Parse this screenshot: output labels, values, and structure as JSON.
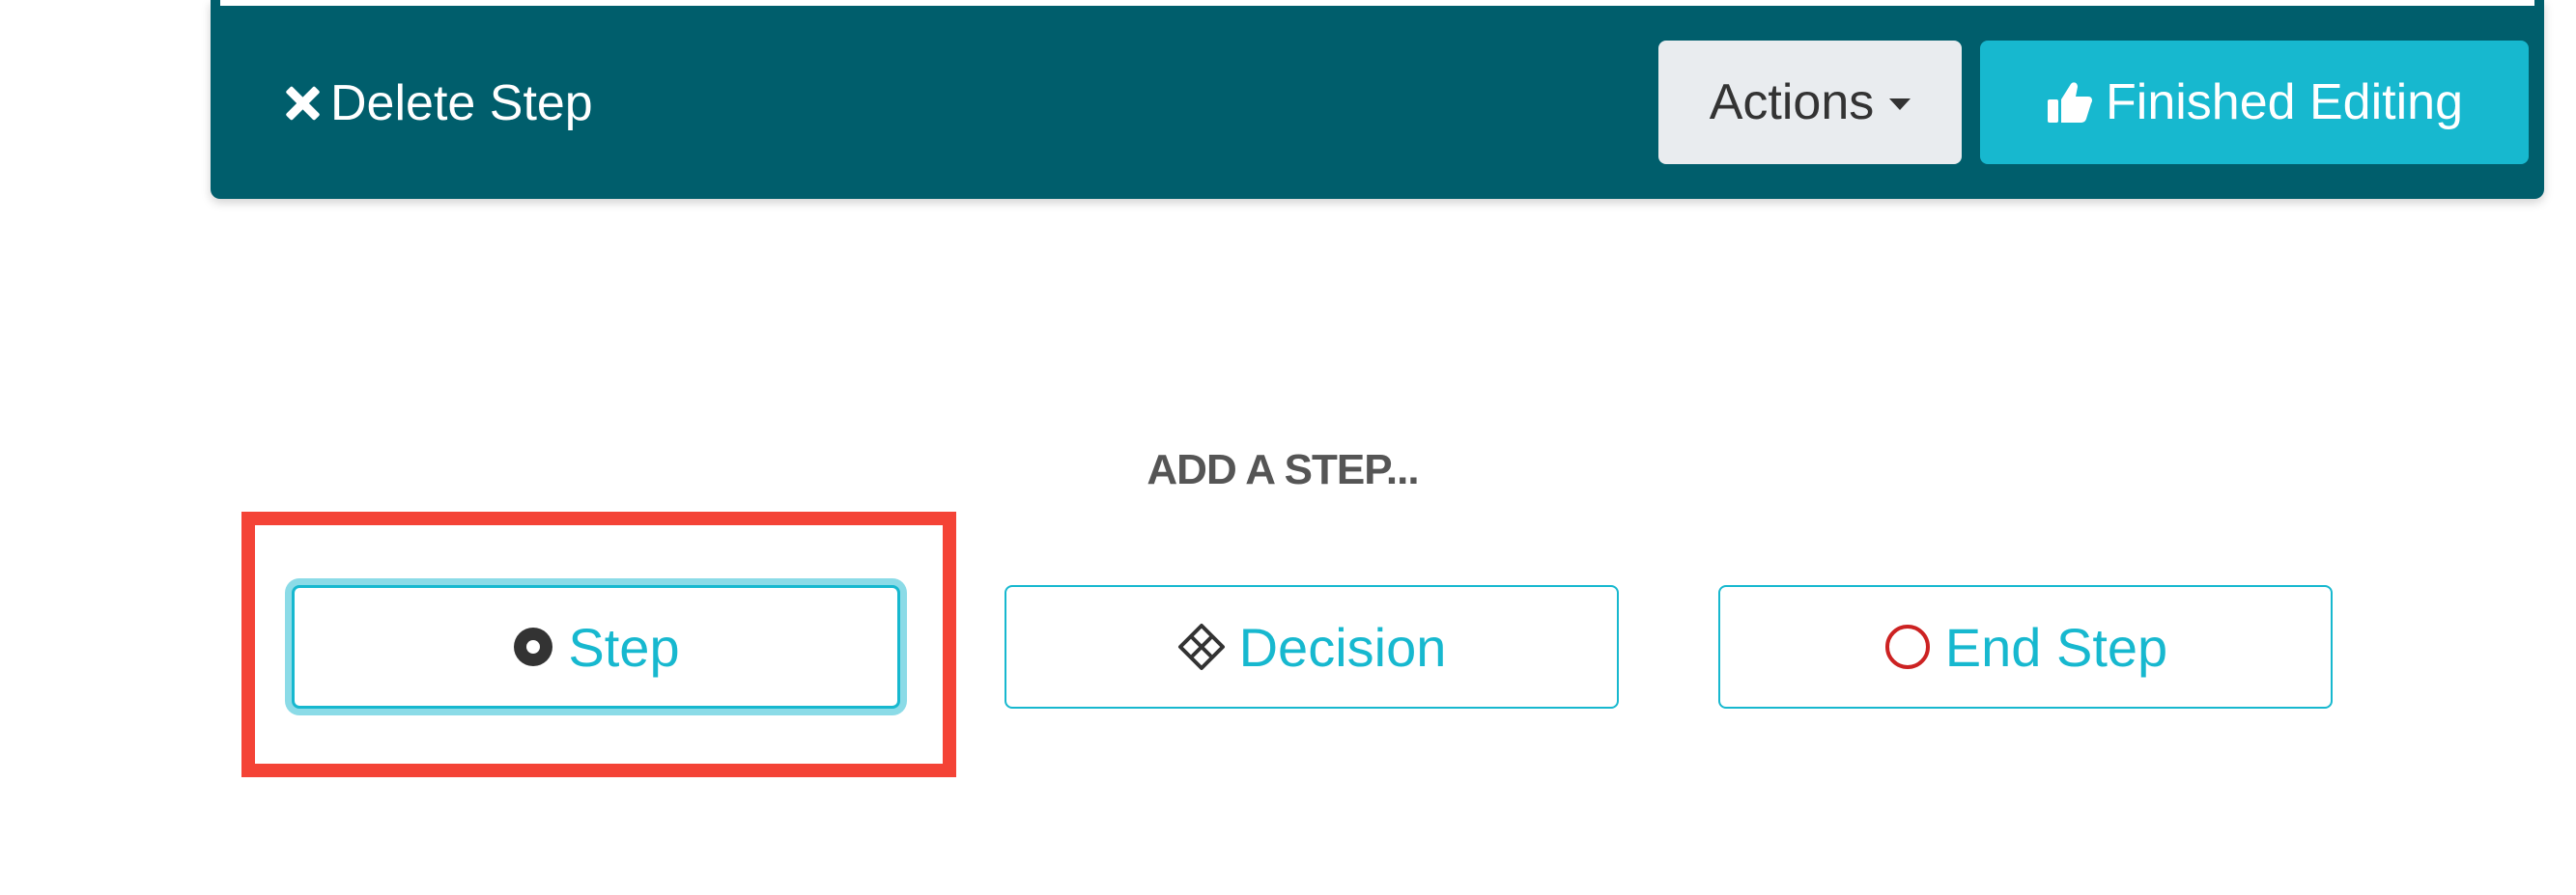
{
  "step_card": {
    "delete_label": "Delete Step",
    "actions_label": "Actions",
    "finished_label": "Finished Editing"
  },
  "add_step": {
    "heading": "ADD A STEP...",
    "buttons": [
      {
        "label": "Step",
        "icon": "dot-circle-icon"
      },
      {
        "label": "Decision",
        "icon": "diamond-icon"
      },
      {
        "label": "End Step",
        "icon": "circle-icon"
      }
    ]
  },
  "colors": {
    "card_bg": "#005e6c",
    "accent": "#17b8cf",
    "actions_bg": "#e9ecef",
    "highlight": "#f44336",
    "end_icon": "#cc2222"
  }
}
